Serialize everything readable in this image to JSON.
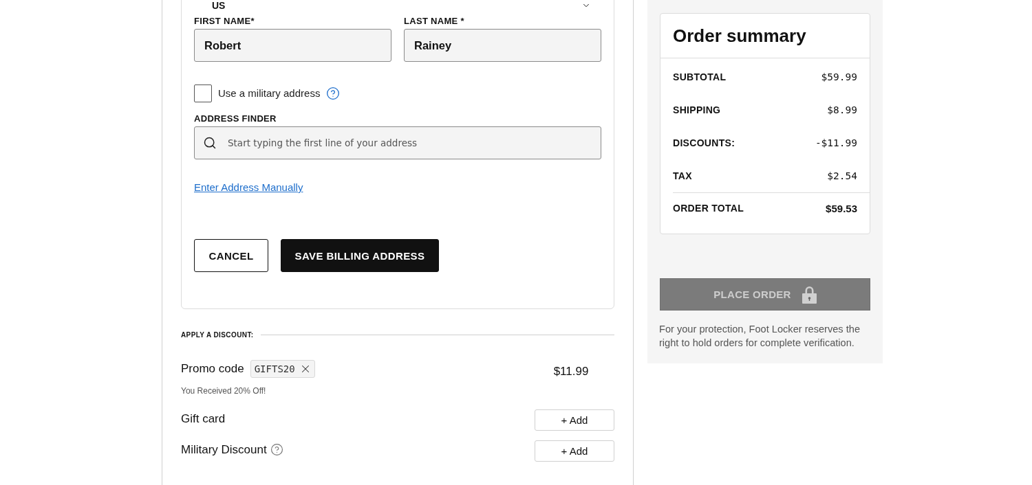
{
  "billing_form": {
    "country": {
      "value": "US"
    },
    "first_name": {
      "label": "FIRST NAME*",
      "value": "Robert"
    },
    "last_name": {
      "label": "LAST NAME *",
      "value": "Rainey"
    },
    "military_address": {
      "label": "Use a military address",
      "checked": false
    },
    "address_finder": {
      "label": "ADDRESS FINDER",
      "placeholder": "Start typing the first line of your address"
    },
    "manual_link": "Enter Address Manually",
    "buttons": [
      {
        "label": "CANCEL",
        "kind": "secondary"
      },
      {
        "label": "SAVE BILLING ADDRESS",
        "kind": "primary"
      }
    ]
  },
  "discount": {
    "heading": "APPLY A DISCOUNT:",
    "promo": {
      "label": "Promo code",
      "code": "GIFTS20",
      "amount": "$11.99",
      "note": "You Received 20% Off!"
    },
    "options": [
      {
        "label": "Gift card",
        "button": "+ Add",
        "help": false
      },
      {
        "label": "Military Discount",
        "button": "+ Add",
        "help": true
      }
    ]
  },
  "order_summary": {
    "title": "Order summary",
    "rows": [
      {
        "label": "SUBTOTAL",
        "value": "$59.99",
        "kind": "line"
      },
      {
        "label": "SHIPPING",
        "value": "$8.99",
        "kind": "line"
      },
      {
        "label": "DISCOUNTS:",
        "value": "-$11.99",
        "kind": "line"
      },
      {
        "label": "TAX",
        "value": "$2.54",
        "kind": "line"
      },
      {
        "label": "ORDER TOTAL",
        "value": "$59.53",
        "kind": "total"
      }
    ]
  },
  "place_order": {
    "label": "PLACE ORDER",
    "disabled": true
  },
  "note": "For your protection, Foot Locker reserves the right to hold orders for complete verification."
}
